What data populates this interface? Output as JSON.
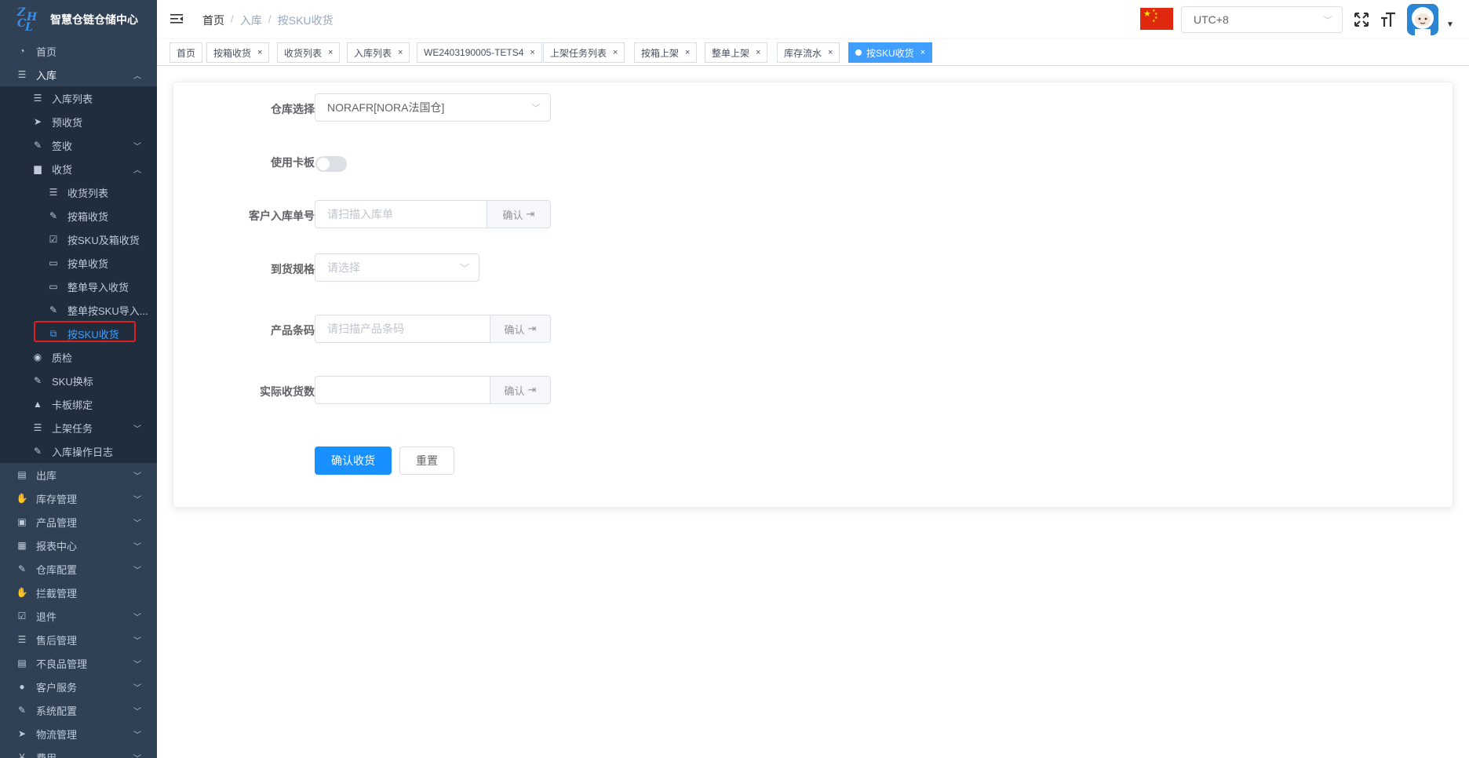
{
  "app": {
    "title": "智慧仓链仓储中心",
    "logo_letters": [
      "Z",
      "H",
      "C",
      "L"
    ]
  },
  "sidebar": {
    "items": [
      {
        "label": "首页",
        "icon": "dashboard-icon",
        "level": 1
      },
      {
        "label": "入库",
        "icon": "list-icon",
        "level": 1,
        "arrow": "up"
      },
      {
        "label": "入库列表",
        "icon": "list-icon",
        "level": 2
      },
      {
        "label": "预收货",
        "icon": "send-icon",
        "level": 2
      },
      {
        "label": "签收",
        "icon": "edit-icon",
        "level": 2,
        "arrow": "down"
      },
      {
        "label": "收货",
        "icon": "clipboard-icon",
        "level": 2,
        "arrow": "up"
      },
      {
        "label": "收货列表",
        "icon": "list-icon",
        "level": 3
      },
      {
        "label": "按箱收货",
        "icon": "edit-icon",
        "level": 3
      },
      {
        "label": "按SKU及箱收货",
        "icon": "checkbox-icon",
        "level": 3
      },
      {
        "label": "按单收货",
        "icon": "monitor-icon",
        "level": 3
      },
      {
        "label": "整单导入收货",
        "icon": "rectangle-icon",
        "level": 3
      },
      {
        "label": "整单按SKU导入...",
        "icon": "edit-icon",
        "level": 3
      },
      {
        "label": "按SKU收货",
        "icon": "external-link-icon",
        "level": 3,
        "active": true
      },
      {
        "label": "质检",
        "icon": "eye-icon",
        "level": 2
      },
      {
        "label": "SKU换标",
        "icon": "edit-icon",
        "level": 2
      },
      {
        "label": "卡板绑定",
        "icon": "lock-icon",
        "level": 2
      },
      {
        "label": "上架任务",
        "icon": "list-icon",
        "level": 2,
        "arrow": "down"
      },
      {
        "label": "入库操作日志",
        "icon": "edit-icon",
        "level": 2
      },
      {
        "label": "出库",
        "icon": "server-icon",
        "level": 1,
        "arrow": "down"
      },
      {
        "label": "库存管理",
        "icon": "drag-icon",
        "level": 1,
        "arrow": "down"
      },
      {
        "label": "产品管理",
        "icon": "briefcase-icon",
        "level": 1,
        "arrow": "down"
      },
      {
        "label": "报表中心",
        "icon": "chart-icon",
        "level": 1,
        "arrow": "down"
      },
      {
        "label": "仓库配置",
        "icon": "edit-icon",
        "level": 1,
        "arrow": "down"
      },
      {
        "label": "拦截管理",
        "icon": "drag-icon",
        "level": 1
      },
      {
        "label": "退件",
        "icon": "checkbox-icon",
        "level": 1,
        "arrow": "down"
      },
      {
        "label": "售后管理",
        "icon": "list-icon",
        "level": 1,
        "arrow": "down"
      },
      {
        "label": "不良品管理",
        "icon": "server-icon",
        "level": 1,
        "arrow": "down"
      },
      {
        "label": "客户服务",
        "icon": "users-icon",
        "level": 1,
        "arrow": "down"
      },
      {
        "label": "系统配置",
        "icon": "edit-icon",
        "level": 1,
        "arrow": "down"
      },
      {
        "label": "物流管理",
        "icon": "send-icon",
        "level": 1,
        "arrow": "down"
      },
      {
        "label": "费用",
        "icon": "yen-icon",
        "level": 1,
        "arrow": "down"
      }
    ]
  },
  "header": {
    "breadcrumb": [
      "首页",
      "入库",
      "按SKU收货"
    ],
    "timezone": "UTC+8"
  },
  "tags": [
    {
      "label": "首页",
      "closable": false
    },
    {
      "label": "按箱收货",
      "closable": true
    },
    {
      "label": "收货列表",
      "closable": true
    },
    {
      "label": "入库列表",
      "closable": true
    },
    {
      "label": "WE2403190005-TETS4",
      "closable": true
    },
    {
      "label": "上架任务列表",
      "closable": true
    },
    {
      "label": "按箱上架",
      "closable": true
    },
    {
      "label": "整单上架",
      "closable": true
    },
    {
      "label": "库存流水",
      "closable": true
    },
    {
      "label": "按SKU收货",
      "closable": true,
      "active": true
    }
  ],
  "form": {
    "warehouse_label": "仓库选择",
    "warehouse_value": "NORAFR[NORA法国仓]",
    "pallet_label": "使用卡板",
    "pallet_enabled": false,
    "customer_order_label": "客户入库单号",
    "customer_order_placeholder": "请扫描入库单",
    "customer_order_value": "",
    "confirm_label": "确认",
    "arrival_spec_label": "到货规格",
    "arrival_spec_placeholder": "请选择",
    "barcode_label": "产品条码",
    "barcode_placeholder": "请扫描产品条码",
    "actual_qty_label": "实际收货数",
    "actual_qty_value": "",
    "submit_label": "确认收货",
    "reset_label": "重置"
  },
  "colors": {
    "sidebar_bg": "#304156",
    "submenu_bg": "#1f2d3d",
    "primary": "#1890ff",
    "active_tag": "#409eff",
    "highlight_box": "#e02020"
  }
}
